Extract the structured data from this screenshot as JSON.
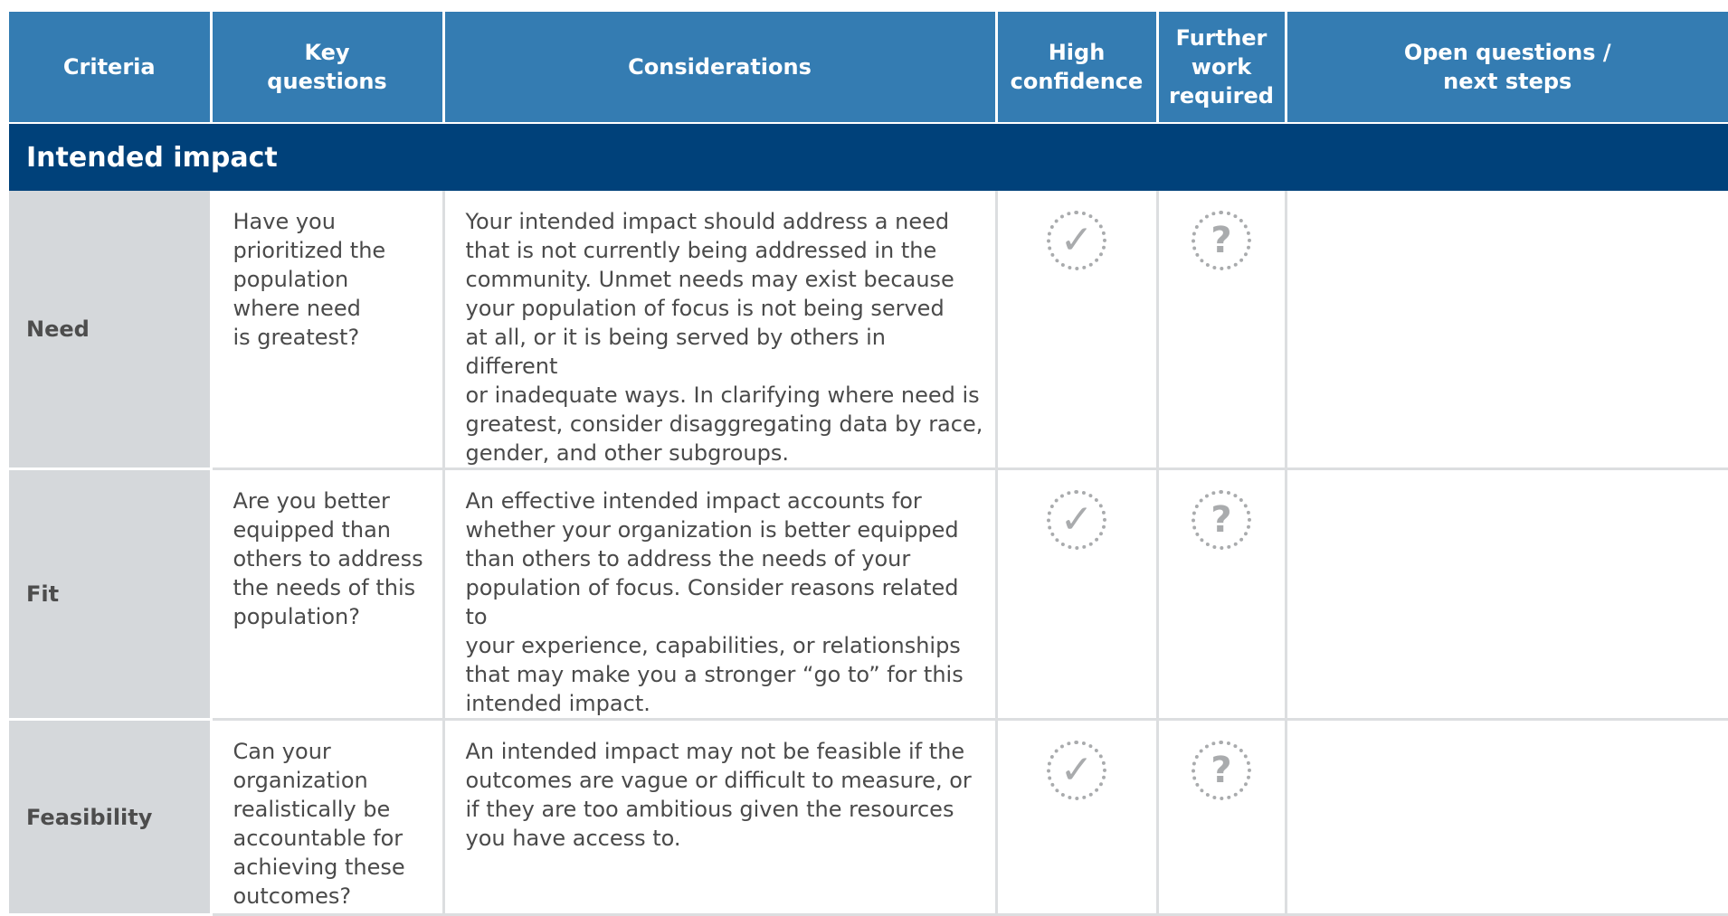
{
  "header": {
    "criteria": "Criteria",
    "key_questions": "Key\nquestions",
    "considerations": "Considerations",
    "high_confidence": "High\nconfidence",
    "further_work": "Further\nwork\nrequired",
    "open_questions": "Open questions /\nnext steps"
  },
  "section": {
    "title": "Intended impact"
  },
  "icons": {
    "check": "✓",
    "question": "?"
  },
  "rows": [
    {
      "criteria": "Need",
      "key_question": "Have you\nprioritized the\npopulation\nwhere need\nis greatest?",
      "consideration": "Your intended impact should address a need\nthat is not currently being addressed in the\ncommunity. Unmet needs may exist because\nyour population of focus is not being served\nat all, or it is being served by others in different\nor inadequate ways. In clarifying where need is\ngreatest, consider disaggregating data by race,\ngender, and other subgroups."
    },
    {
      "criteria": "Fit",
      "key_question": "Are you better\nequipped than\nothers to address\nthe needs of this\npopulation?",
      "consideration": "An effective intended impact accounts for\nwhether your organization is better equipped\nthan others to address the needs of your\npopulation of focus. Consider reasons related to\nyour experience, capabilities, or relationships\nthat may make you a stronger “go to” for this\nintended impact."
    },
    {
      "criteria": "Feasibility",
      "key_question": "Can your\norganization\nrealistically be\naccountable for\nachieving these\noutcomes?",
      "consideration": "An intended impact may not be feasible if the\noutcomes are vague or difficult to measure, or\nif they are too ambitious given the resources\nyou have access to."
    }
  ]
}
